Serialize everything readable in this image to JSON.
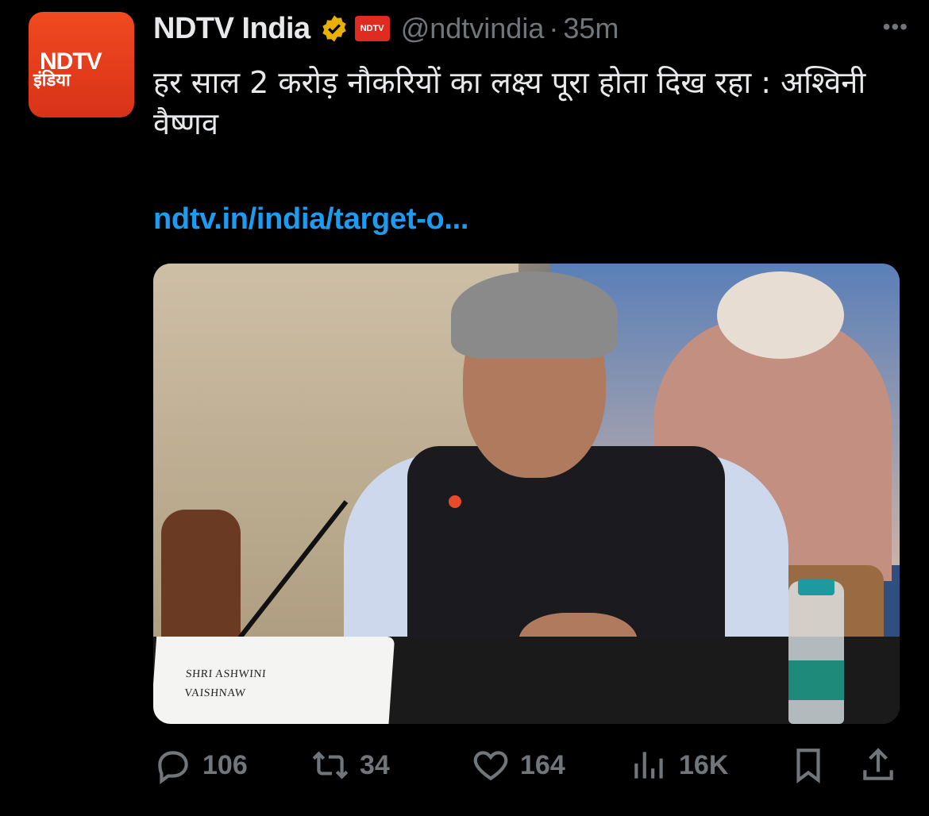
{
  "tweet": {
    "avatar": {
      "logo_en": "NDTV",
      "logo_hi": "इंडिया"
    },
    "author_name": "NDTV India",
    "affiliate_badge": "NDTV",
    "handle": "@ndtvindia",
    "separator": "·",
    "time": "35m",
    "more": "•••",
    "text": "हर साल 2 करोड़ नौकरियों का लक्ष्य पूरा होता दिख रहा : अश्विनी वैष्णव",
    "link": "ndtv.in/india/target-o...",
    "media": {
      "nameplate_line1": "SHRI ASHWINI",
      "nameplate_line2": "VAISHNAW"
    },
    "actions": {
      "replies": "106",
      "reposts": "34",
      "likes": "164",
      "views": "16K"
    }
  },
  "colors": {
    "link": "#1d9bf0",
    "muted": "#71767b",
    "verified": "#e8b000",
    "brand": "#e02b21"
  },
  "icons": [
    "verified-icon",
    "reply-icon",
    "repost-icon",
    "like-icon",
    "views-icon",
    "bookmark-icon",
    "share-icon"
  ]
}
